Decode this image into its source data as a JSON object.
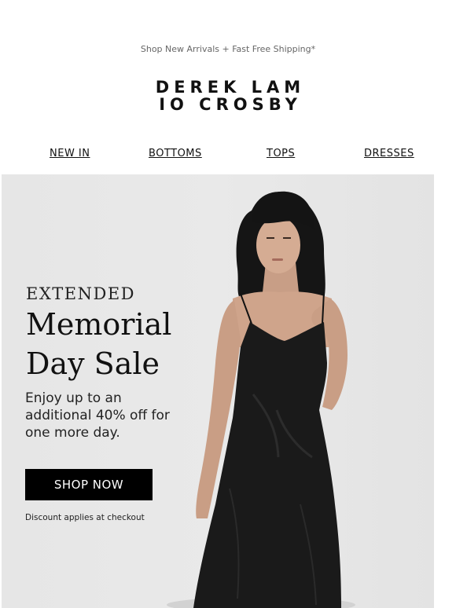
{
  "preheader": {
    "text": "Shop New Arrivals + Fast Free Shipping*"
  },
  "brand": {
    "line1": "DEREK LAM",
    "line2": "IO CROSBY"
  },
  "nav": {
    "items": [
      {
        "label": "NEW IN"
      },
      {
        "label": "BOTTOMS"
      },
      {
        "label": "TOPS"
      },
      {
        "label": "DRESSES"
      }
    ]
  },
  "hero": {
    "eyebrow": "EXTENDED",
    "headline_line1": "Memorial",
    "headline_line2": "Day Sale",
    "subcopy": "Enjoy up to an additional 40% off for one more day.",
    "cta_label": "SHOP NOW",
    "fineprint": "Discount applies at checkout",
    "image": "model-in-black-slip-dress"
  },
  "colors": {
    "background": "#ffffff",
    "hero_bg": "#e7e7e7",
    "cta_bg": "#000000",
    "cta_text": "#ffffff",
    "text": "#111111"
  }
}
